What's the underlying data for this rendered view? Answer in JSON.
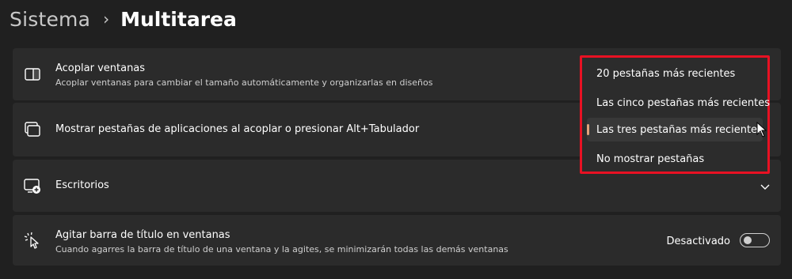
{
  "breadcrumb": {
    "parent": "Sistema",
    "separator": "›",
    "current": "Multitarea"
  },
  "cards": {
    "snap": {
      "title": "Acoplar ventanas",
      "description": "Acoplar ventanas para cambiar el tamaño automáticamente y organizarlas en diseños",
      "icon": "snap-windows-icon"
    },
    "alttab": {
      "title": "Mostrar pestañas de aplicaciones al acoplar o presionar Alt+Tabulador",
      "icon": "stacked-windows-icon"
    },
    "desktops": {
      "title": "Escritorios",
      "icon": "desktop-add-icon"
    },
    "shake": {
      "title": "Agitar barra de título en ventanas",
      "description": "Cuando agarres la barra de título de una ventana y la agites, se minimizarán todas las demás ventanas",
      "icon": "shake-pointer-icon",
      "toggle_label": "Desactivado",
      "toggle_on": false
    }
  },
  "dropdown": {
    "options": [
      "20 pestañas más recientes",
      "Las cinco pestañas más recientes",
      "Las tres pestañas más recientes",
      "No mostrar pestañas"
    ],
    "selected": "Las tres pestañas más recientes",
    "highlight_color": "#e81123",
    "accent_color": "#e0a37a"
  }
}
